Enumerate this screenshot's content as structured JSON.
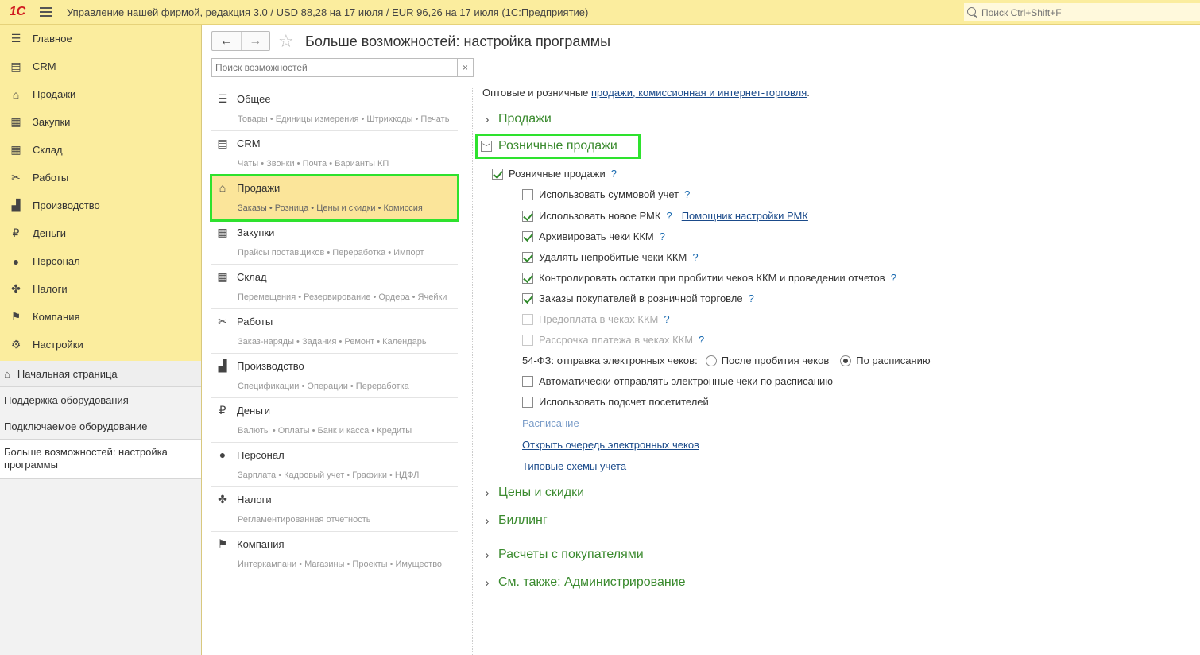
{
  "app": {
    "logo": "1С",
    "title": "Управление нашей фирмой, редакция 3.0 / USD 88,28 на 17 июля / EUR 96,26 на 17 июля  (1С:Предприятие)",
    "search_placeholder": "Поиск Ctrl+Shift+F"
  },
  "nav": {
    "items": [
      {
        "label": "Главное",
        "icon": "list-icon",
        "glyph": "☰"
      },
      {
        "label": "CRM",
        "icon": "contact-card-icon",
        "glyph": "▤"
      },
      {
        "label": "Продажи",
        "icon": "basket-icon",
        "glyph": "⌂"
      },
      {
        "label": "Закупки",
        "icon": "cart-icon",
        "glyph": "▦"
      },
      {
        "label": "Склад",
        "icon": "warehouse-icon",
        "glyph": "▦"
      },
      {
        "label": "Работы",
        "icon": "tools-icon",
        "glyph": "✂"
      },
      {
        "label": "Производство",
        "icon": "factory-icon",
        "glyph": "▟"
      },
      {
        "label": "Деньги",
        "icon": "ruble-icon",
        "glyph": "₽"
      },
      {
        "label": "Персонал",
        "icon": "person-icon",
        "glyph": "●"
      },
      {
        "label": "Налоги",
        "icon": "emblem-icon",
        "glyph": "✤"
      },
      {
        "label": "Компания",
        "icon": "flag-icon",
        "glyph": "⚑"
      },
      {
        "label": "Настройки",
        "icon": "gear-icon",
        "glyph": "⚙"
      }
    ],
    "open_windows": {
      "home": "Начальная страница",
      "w1": "Поддержка оборудования",
      "w2": "Подключаемое оборудование",
      "w3": "Больше возможностей: настройка программы"
    }
  },
  "page": {
    "title": "Больше возможностей: настройка программы",
    "search_placeholder": "Поиск возможностей",
    "clear": "×",
    "back": "←",
    "forward": "→",
    "star": "☆"
  },
  "categories": [
    {
      "title": "Общее",
      "sub": "Товары • Единицы измерения • Штрихкоды • Печать",
      "glyph": "☰",
      "icon": "list-icon"
    },
    {
      "title": "CRM",
      "sub": "Чаты • Звонки • Почта • Варианты КП",
      "glyph": "▤",
      "icon": "contact-card-icon"
    },
    {
      "title": "Продажи",
      "sub": "Заказы • Розница • Цены и скидки • Комиссия",
      "glyph": "⌂",
      "icon": "basket-icon"
    },
    {
      "title": "Закупки",
      "sub": "Прайсы поставщиков • Переработка • Импорт",
      "glyph": "▦",
      "icon": "cart-icon"
    },
    {
      "title": "Склад",
      "sub": "Перемещения • Резервирование • Ордера • Ячейки",
      "glyph": "▦",
      "icon": "warehouse-icon"
    },
    {
      "title": "Работы",
      "sub": "Заказ-наряды • Задания • Ремонт • Календарь",
      "glyph": "✂",
      "icon": "tools-icon"
    },
    {
      "title": "Производство",
      "sub": "Спецификации • Операции • Переработка",
      "glyph": "▟",
      "icon": "factory-icon"
    },
    {
      "title": "Деньги",
      "sub": "Валюты • Оплаты • Банк и касса • Кредиты",
      "glyph": "₽",
      "icon": "ruble-icon"
    },
    {
      "title": "Персонал",
      "sub": "Зарплата • Кадровый учет • Графики • НДФЛ",
      "glyph": "●",
      "icon": "person-icon"
    },
    {
      "title": "Налоги",
      "sub": "Регламентированная отчетность",
      "glyph": "✤",
      "icon": "emblem-icon"
    },
    {
      "title": "Компания",
      "sub": "Интеркампани • Магазины • Проекты • Имущество",
      "glyph": "⚑",
      "icon": "flag-icon"
    }
  ],
  "content": {
    "intro_text": "Оптовые и розничные ",
    "intro_link": "продажи, комиссионная и интернет-торговля",
    "intro_end": ".",
    "sections": {
      "sales": "Продажи",
      "retail": "Розничные продажи",
      "prices": "Цены и скидки",
      "billing": "Биллинг",
      "settlements": "Расчеты с покупателями",
      "see_also": "См. также: Администрирование"
    },
    "help": "?",
    "retail_main": "Розничные продажи",
    "options": {
      "o1": "Использовать суммовой учет",
      "o2": "Использовать новое РМК",
      "o2_link": "Помощник настройки РМК",
      "o3": "Архивировать чеки ККМ",
      "o4": "Удалять непробитые чеки ККМ",
      "o5": "Контролировать остатки при пробитии чеков ККМ и проведении отчетов",
      "o6": "Заказы покупателей в розничной торговле",
      "o7": "Предоплата в чеках ККМ",
      "o8": "Рассрочка платежа в чеках ККМ",
      "fz_label": "54-ФЗ: отправка электронных чеков:",
      "fz_opt1": "После пробития чеков",
      "fz_opt2": "По расписанию",
      "o9": "Автоматически отправлять электронные чеки по расписанию",
      "o10": "Использовать подсчет посетителей"
    },
    "links": {
      "schedule": "Расписание",
      "queue": "Открыть очередь электронных чеков",
      "schemes": "Типовые схемы учета"
    }
  }
}
